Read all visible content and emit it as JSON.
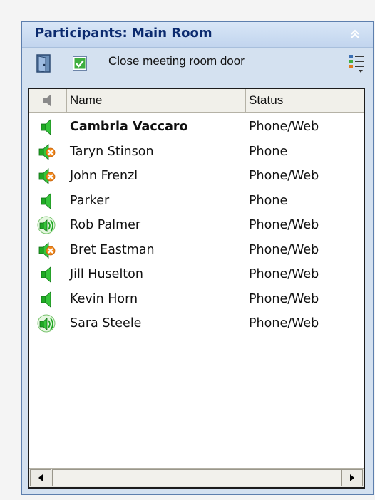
{
  "panel": {
    "title": "Participants: Main Room",
    "close_door_label": "Close meeting room door",
    "close_door_checked": true
  },
  "columns": {
    "name": "Name",
    "status": "Status"
  },
  "participants": [
    {
      "name": "Cambria Vaccaro",
      "status": "Phone/Web",
      "icon": "speaker-icon",
      "bold": true
    },
    {
      "name": "Taryn Stinson",
      "status": "Phone",
      "icon": "speaker-muted-icon",
      "bold": false
    },
    {
      "name": "John Frenzl",
      "status": "Phone/Web",
      "icon": "speaker-muted-icon",
      "bold": false
    },
    {
      "name": "Parker",
      "status": "Phone",
      "icon": "speaker-icon",
      "bold": false
    },
    {
      "name": "Rob Palmer",
      "status": "Phone/Web",
      "icon": "speaker-talking-icon",
      "bold": false
    },
    {
      "name": "Bret Eastman",
      "status": "Phone/Web",
      "icon": "speaker-muted-icon",
      "bold": false
    },
    {
      "name": "Jill Huselton",
      "status": "Phone/Web",
      "icon": "speaker-icon",
      "bold": false
    },
    {
      "name": "Kevin Horn",
      "status": "Phone/Web",
      "icon": "speaker-icon",
      "bold": false
    },
    {
      "name": "Sara Steele",
      "status": "Phone/Web",
      "icon": "speaker-talking-icon",
      "bold": false
    }
  ],
  "colors": {
    "title_text": "#0b2a6e",
    "panel_bg": "#d4e1f0",
    "speaker_green": "#1fa824",
    "mute_orange": "#f28a1e"
  }
}
